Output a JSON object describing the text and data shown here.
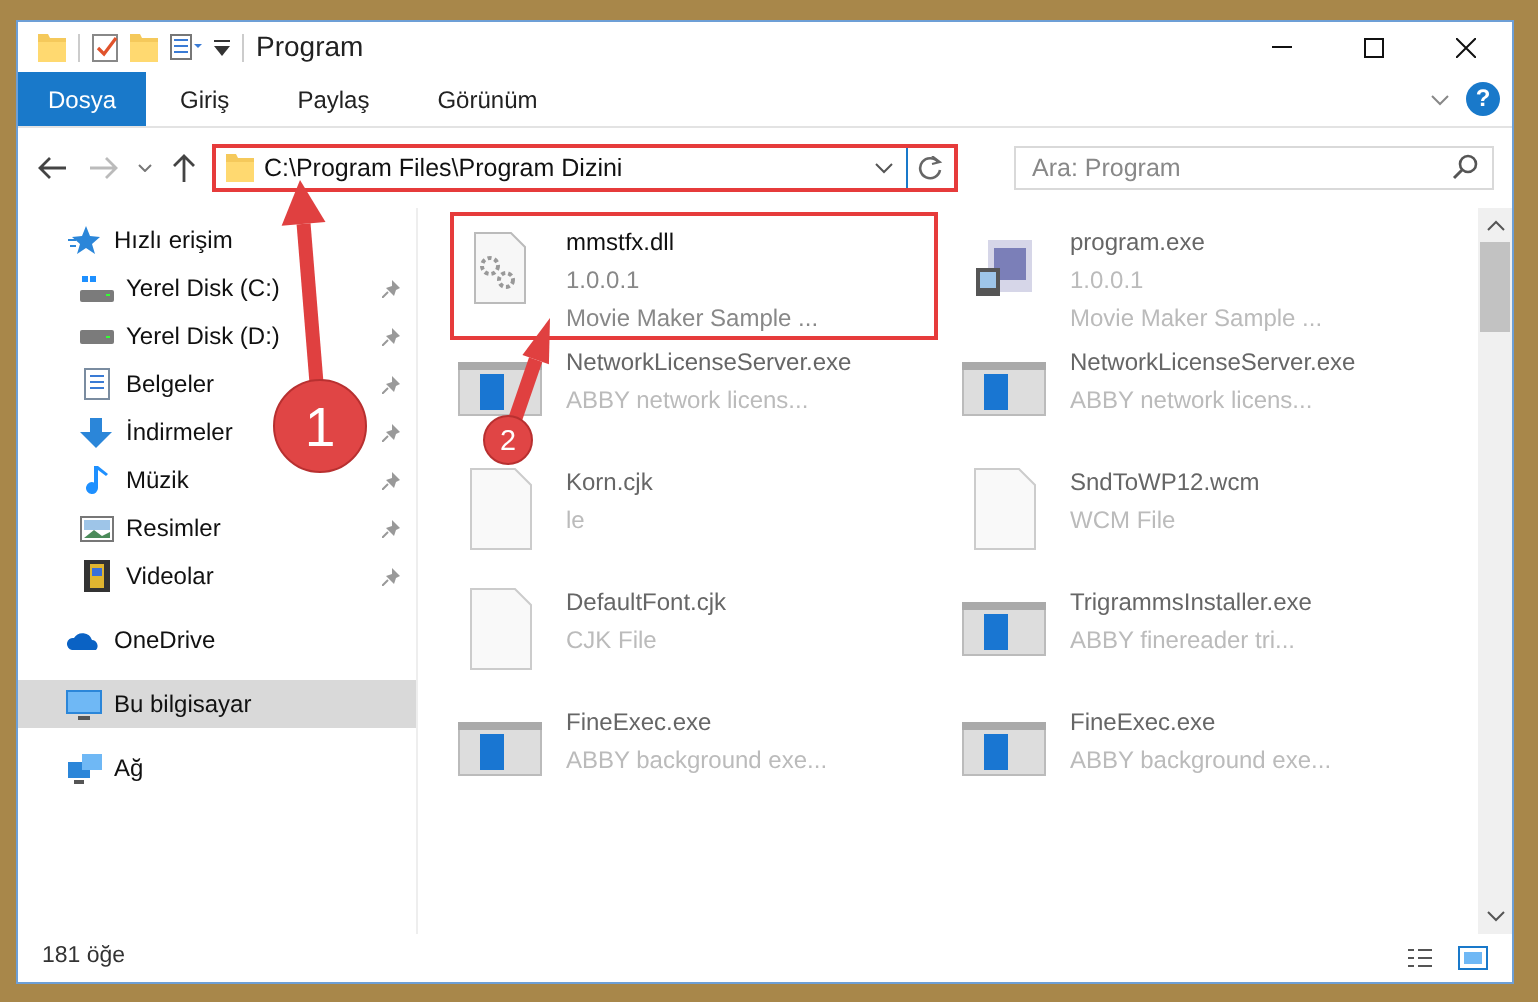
{
  "window": {
    "title": "Program"
  },
  "ribbon_tabs": [
    {
      "label": "Dosya",
      "selected": true
    },
    {
      "label": "Giriş",
      "selected": false
    },
    {
      "label": "Paylaş",
      "selected": false
    },
    {
      "label": "Görünüm",
      "selected": false
    }
  ],
  "help_button": {
    "label": "?"
  },
  "address": {
    "path": "C:\\Program Files\\Program Dizini",
    "highlighted": true
  },
  "search": {
    "placeholder": "Ara: Program"
  },
  "sidebar": {
    "items": [
      {
        "label": "Hızlı erişim",
        "kind": "star",
        "selected": false,
        "children": [
          {
            "label": "Yerel Disk (C:)",
            "kind": "disk-c",
            "pinned": true
          },
          {
            "label": "Yerel Disk (D:)",
            "kind": "disk",
            "pinned": true
          },
          {
            "label": "Belgeler",
            "kind": "doc",
            "pinned": true
          },
          {
            "label": "İndirmeler",
            "kind": "download",
            "pinned": true
          },
          {
            "label": "Müzik",
            "kind": "music",
            "pinned": true
          },
          {
            "label": "Resimler",
            "kind": "image",
            "pinned": true
          },
          {
            "label": "Videolar",
            "kind": "video",
            "pinned": true
          }
        ]
      },
      {
        "label": "OneDrive",
        "kind": "cloud",
        "selected": false
      },
      {
        "label": "Bu bilgisayar",
        "kind": "pc",
        "selected": true
      },
      {
        "label": "Ağ",
        "kind": "network",
        "selected": false
      }
    ]
  },
  "files": [
    {
      "name": "mmstfx.dll",
      "details": [
        "1.0.0.1",
        "Movie Maker Sample ..."
      ],
      "kind": "dll",
      "highlighted": true
    },
    {
      "name": "program.exe",
      "details": [
        "1.0.0.1",
        "Movie Maker Sample ..."
      ],
      "kind": "app",
      "highlighted": false
    },
    {
      "name": "NetworkLicenseServer.exe",
      "details": [
        "ABBY network licens..."
      ],
      "kind": "window",
      "highlighted": false
    },
    {
      "name": "NetworkLicenseServer.exe",
      "details": [
        "ABBY network licens..."
      ],
      "kind": "window",
      "highlighted": false
    },
    {
      "name": "Korn.cjk",
      "details": [
        "le"
      ],
      "kind": "blank",
      "highlighted": false
    },
    {
      "name": "SndToWP12.wcm",
      "details": [
        "WCM File"
      ],
      "kind": "blank",
      "highlighted": false
    },
    {
      "name": "DefaultFont.cjk",
      "details": [
        "CJK File"
      ],
      "kind": "blank",
      "highlighted": false
    },
    {
      "name": "TrigrammsInstaller.exe",
      "details": [
        "ABBY finereader tri..."
      ],
      "kind": "window",
      "highlighted": false
    },
    {
      "name": "FineExec.exe",
      "details": [
        "ABBY background exe..."
      ],
      "kind": "window",
      "highlighted": false
    },
    {
      "name": "FineExec.exe",
      "details": [
        "ABBY background exe..."
      ],
      "kind": "window",
      "highlighted": false
    }
  ],
  "status_bar": {
    "count": "181 öğe"
  },
  "annotations": [
    {
      "number": "1"
    },
    {
      "number": "2"
    }
  ]
}
